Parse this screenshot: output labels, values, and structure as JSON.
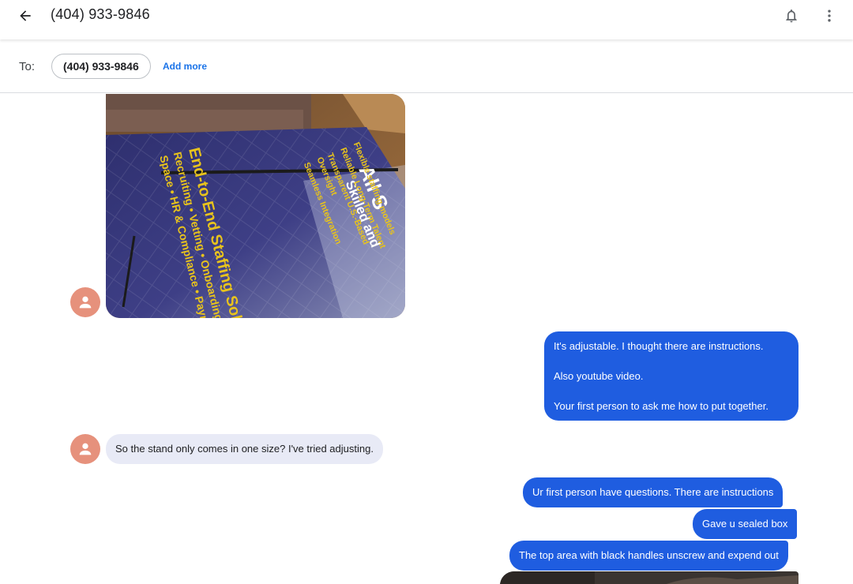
{
  "header": {
    "title": "(404) 933-9846",
    "back_icon": "arrow-back-icon",
    "notification_icon": "bell-icon",
    "more_icon": "more-vert-icon"
  },
  "recipients": {
    "to_label": "To:",
    "chips": [
      "(404) 933-9846"
    ],
    "add_more_label": "Add more"
  },
  "messages": [
    {
      "direction": "incoming",
      "type": "image",
      "image_text": [
        "All S",
        "Skilled and",
        "End-to-End Staffing Solutio",
        "Recruiting • Vetting • Onboarding • Secure",
        "Space • HR & Compliance • Payroll Manag",
        "Flexible staffing models",
        "Reliable Long-Term Talent",
        "Transparent U.S.-Based",
        "Oversight",
        "Seamless Integration"
      ]
    },
    {
      "direction": "outgoing",
      "type": "text",
      "lines": [
        "It's adjustable.  I thought there are instructions.",
        "Also youtube video.",
        "Your first person to ask me how to put together."
      ]
    },
    {
      "direction": "incoming",
      "type": "text",
      "text": "So the stand only comes in one size? I've tried adjusting."
    },
    {
      "direction": "outgoing",
      "type": "text",
      "text": "Ur first person have questions. There are instructions"
    },
    {
      "direction": "outgoing",
      "type": "text",
      "text": "Gave u sealed box"
    },
    {
      "direction": "outgoing",
      "type": "text",
      "text": "The top area with black handles unscrew and expend out"
    },
    {
      "direction": "outgoing",
      "type": "image"
    }
  ],
  "colors": {
    "outgoing_bubble": "#1f5de0",
    "incoming_bubble": "#e8eaf6",
    "avatar": "#e6917c",
    "accent_link": "#1a73e8"
  }
}
